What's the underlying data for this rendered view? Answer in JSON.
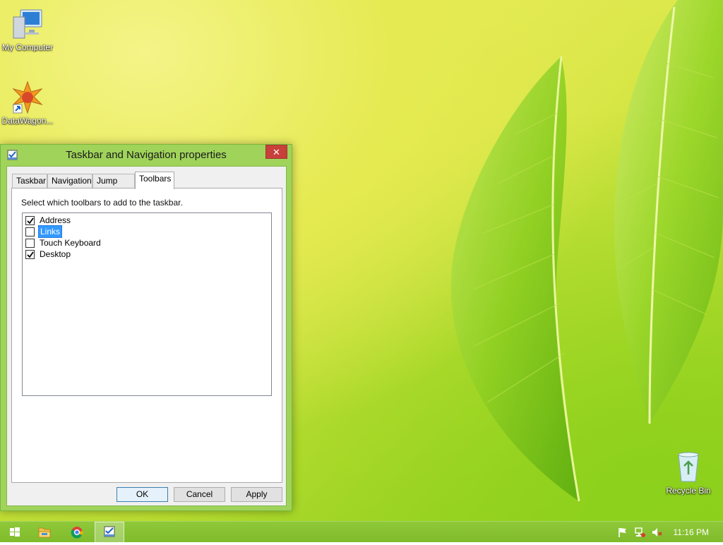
{
  "desktop": {
    "icons": [
      {
        "label": "My Computer",
        "icon": "my-computer-icon"
      },
      {
        "label": "DataWagon...",
        "icon": "datawagon-icon"
      },
      {
        "label": "Recycle Bin",
        "icon": "recycle-bin-icon"
      }
    ]
  },
  "dialog": {
    "title": "Taskbar and Navigation properties",
    "close_label": "✕",
    "tabs": [
      {
        "label": "Taskbar"
      },
      {
        "label": "Navigation"
      },
      {
        "label": "Jump Lists"
      },
      {
        "label": "Toolbars"
      }
    ],
    "active_tab": "Toolbars",
    "instruction": "Select which toolbars to add to the taskbar.",
    "toolbars": [
      {
        "label": "Address",
        "checked": true
      },
      {
        "label": "Links",
        "checked": false,
        "selected": true
      },
      {
        "label": "Touch Keyboard",
        "checked": false
      },
      {
        "label": "Desktop",
        "checked": true
      }
    ],
    "buttons": {
      "ok": "OK",
      "cancel": "Cancel",
      "apply": "Apply"
    }
  },
  "taskbar": {
    "items": [
      {
        "icon": "windows-start-icon"
      },
      {
        "icon": "file-explorer-icon"
      },
      {
        "icon": "chrome-icon"
      },
      {
        "icon": "taskbar-properties-icon",
        "active": true
      }
    ],
    "tray": [
      {
        "icon": "action-center-flag-icon"
      },
      {
        "icon": "network-icon"
      },
      {
        "icon": "volume-muted-icon"
      }
    ],
    "clock": "11:16 PM"
  },
  "colors": {
    "window_frame": "#9fd35a",
    "close_button": "#c7403a",
    "selection": "#3399ff",
    "taskbar": "#86c232"
  }
}
